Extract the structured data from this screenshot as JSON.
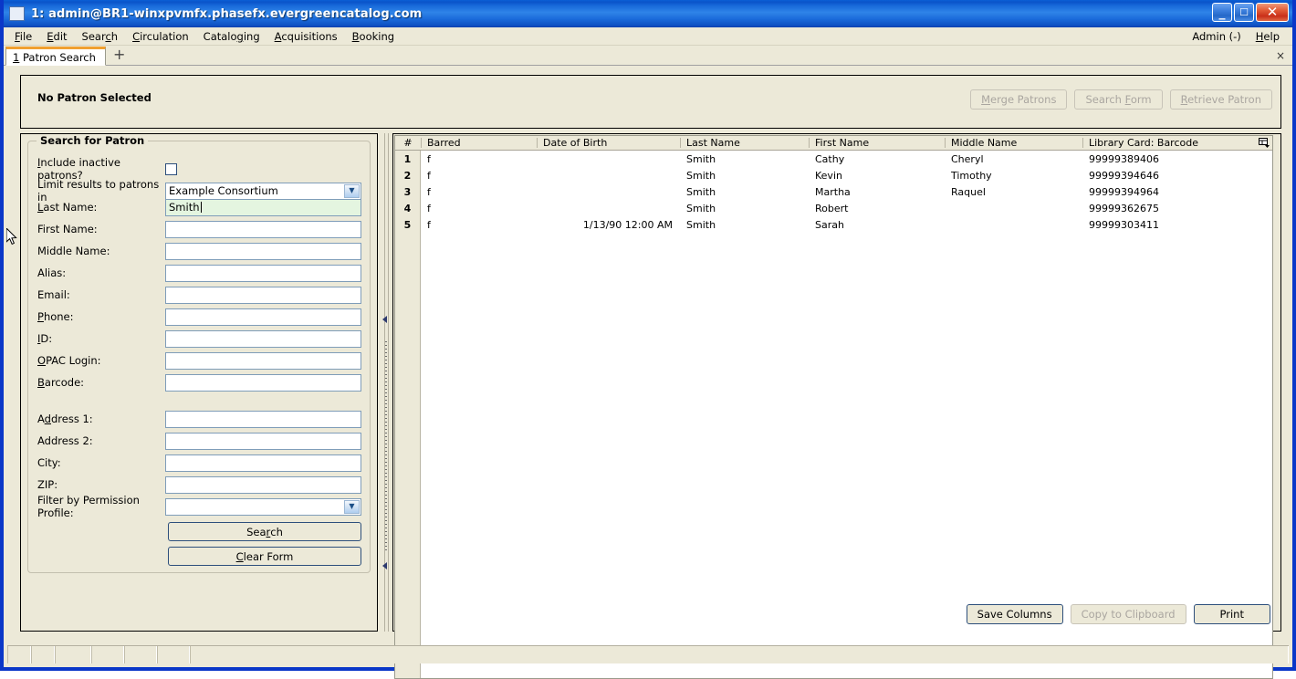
{
  "window": {
    "title": "1: admin@BR1-winxpvmfx.phasefx.evergreencatalog.com",
    "icon": "window-icon",
    "minimize_glyph": "_",
    "maximize_glyph": "☐",
    "close_glyph": "✕"
  },
  "menubar": {
    "items": [
      {
        "label": "File",
        "accel_index": 0
      },
      {
        "label": "Edit",
        "accel_index": 0
      },
      {
        "label": "Search",
        "accel_index": 4
      },
      {
        "label": "Circulation",
        "accel_index": 0
      },
      {
        "label": "Cataloging",
        "accel_index": 6
      },
      {
        "label": "Acquisitions",
        "accel_index": 0
      },
      {
        "label": "Booking",
        "accel_index": 0
      }
    ],
    "right_items": [
      {
        "label": "Admin (-)",
        "accel_index": -1
      },
      {
        "label": "Help",
        "accel_index": 0
      }
    ]
  },
  "tabstrip": {
    "active_tab_number": "1",
    "active_tab_label": "Patron Search",
    "new_tab_glyph": "+",
    "close_glyph": "×"
  },
  "patron_header": {
    "status_label": "No Patron Selected",
    "buttons": [
      {
        "label": "Merge Patrons",
        "accel_index": 0,
        "disabled": true
      },
      {
        "label": "Search Form",
        "accel_index": 7,
        "disabled": true
      },
      {
        "label": "Retrieve Patron",
        "accel_index": 0,
        "disabled": true
      }
    ]
  },
  "search_form": {
    "group_title": "Search for Patron",
    "fields": [
      {
        "label": "Include inactive patrons?",
        "accel_index": 0,
        "type": "checkbox",
        "checked": false
      },
      {
        "label": "Limit results to patrons in",
        "accel_index": -1,
        "type": "select",
        "value": "Example Consortium"
      },
      {
        "label": "Last Name:",
        "accel_index": 0,
        "type": "text",
        "value": "Smith",
        "focused": true
      },
      {
        "label": "First Name:",
        "accel_index": -1,
        "type": "text",
        "value": ""
      },
      {
        "label": "Middle Name:",
        "accel_index": -1,
        "type": "text",
        "value": ""
      },
      {
        "label": "Alias:",
        "accel_index": -1,
        "type": "text",
        "value": ""
      },
      {
        "label": "Email:",
        "accel_index": -1,
        "type": "text",
        "value": ""
      },
      {
        "label": "Phone:",
        "accel_index": 0,
        "type": "text",
        "value": ""
      },
      {
        "label": "ID:",
        "accel_index": 0,
        "type": "text",
        "value": ""
      },
      {
        "label": "OPAC Login:",
        "accel_index": 0,
        "type": "text",
        "value": ""
      },
      {
        "label": "Barcode:",
        "accel_index": 0,
        "type": "text",
        "value": ""
      },
      {
        "label": "Address 1:",
        "accel_index": 1,
        "type": "text",
        "value": ""
      },
      {
        "label": "Address 2:",
        "accel_index": -1,
        "type": "text",
        "value": ""
      },
      {
        "label": "City:",
        "accel_index": -1,
        "type": "text",
        "value": ""
      },
      {
        "label": "ZIP:",
        "accel_index": -1,
        "type": "text",
        "value": ""
      },
      {
        "label": "Filter by Permission Profile:",
        "accel_index": -1,
        "type": "select",
        "value": ""
      }
    ],
    "buttons": [
      {
        "label": "Search",
        "accel_index": 3
      },
      {
        "label": "Clear Form",
        "accel_index": 0
      }
    ]
  },
  "results": {
    "columns": [
      "#",
      "Barred",
      "Date of Birth",
      "Last Name",
      "First Name",
      "Middle Name",
      "Library Card: Barcode"
    ],
    "column_picker_icon": "column-picker-icon",
    "rows": [
      {
        "num": "1",
        "barred": "f",
        "dob": "",
        "last": "Smith",
        "first": "Cathy",
        "middle": "Cheryl",
        "barcode": "99999389406"
      },
      {
        "num": "2",
        "barred": "f",
        "dob": "",
        "last": "Smith",
        "first": "Kevin",
        "middle": "Timothy",
        "barcode": "99999394646"
      },
      {
        "num": "3",
        "barred": "f",
        "dob": "",
        "last": "Smith",
        "first": "Martha",
        "middle": "Raquel",
        "barcode": "99999394964"
      },
      {
        "num": "4",
        "barred": "f",
        "dob": "",
        "last": "Smith",
        "first": "Robert",
        "middle": "",
        "barcode": "99999362675"
      },
      {
        "num": "5",
        "barred": "f",
        "dob": "1/13/90 12:00 AM",
        "last": "Smith",
        "first": "Sarah",
        "middle": "",
        "barcode": "99999303411"
      }
    ],
    "footer_buttons": [
      {
        "label": "Save Columns",
        "disabled": false
      },
      {
        "label": "Copy to Clipboard",
        "disabled": true
      },
      {
        "label": "Print",
        "disabled": false
      }
    ]
  },
  "statusbar": {
    "panes": [
      "",
      "",
      "",
      "",
      "",
      "",
      ""
    ]
  },
  "colors": {
    "titlebar_blue": "#0a54ca",
    "window_border": "#0a37c8",
    "face": "#ece9d8",
    "field_focus_green": "#e4f5e0",
    "tab_accent_orange": "#f0a030",
    "button_border": "#2d4f7c",
    "disabled_text": "#aaa6a0"
  }
}
